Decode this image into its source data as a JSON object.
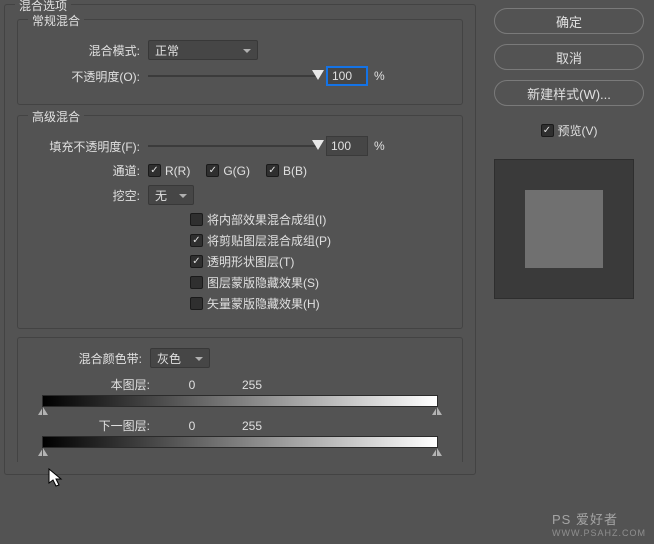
{
  "group_title": "混合选项",
  "general": {
    "legend": "常规混合",
    "blend_mode_label": "混合模式:",
    "blend_mode_value": "正常",
    "opacity_label": "不透明度(O):",
    "opacity_value": "100",
    "opacity_unit": "%"
  },
  "advanced": {
    "legend": "高级混合",
    "fill_opacity_label": "填充不透明度(F):",
    "fill_opacity_value": "100",
    "fill_opacity_unit": "%",
    "channels_label": "通道:",
    "channel_r": "R(R)",
    "channel_g": "G(G)",
    "channel_b": "B(B)",
    "knockout_label": "挖空:",
    "knockout_value": "无",
    "cb1": "将内部效果混合成组(I)",
    "cb2": "将剪贴图层混合成组(P)",
    "cb3": "透明形状图层(T)",
    "cb4": "图层蒙版隐藏效果(S)",
    "cb5": "矢量蒙版隐藏效果(H)"
  },
  "blendif": {
    "label": "混合颜色带:",
    "value": "灰色",
    "this_layer_label": "本图层:",
    "this_layer_low": "0",
    "this_layer_high": "255",
    "underlying_label": "下一图层:",
    "underlying_low": "0",
    "underlying_high": "255"
  },
  "buttons": {
    "ok": "确定",
    "cancel": "取消",
    "new_style": "新建样式(W)...",
    "preview": "预览(V)"
  },
  "watermark": {
    "main": "PS 爱好者",
    "sub": "WWW.PSAHZ.COM"
  }
}
